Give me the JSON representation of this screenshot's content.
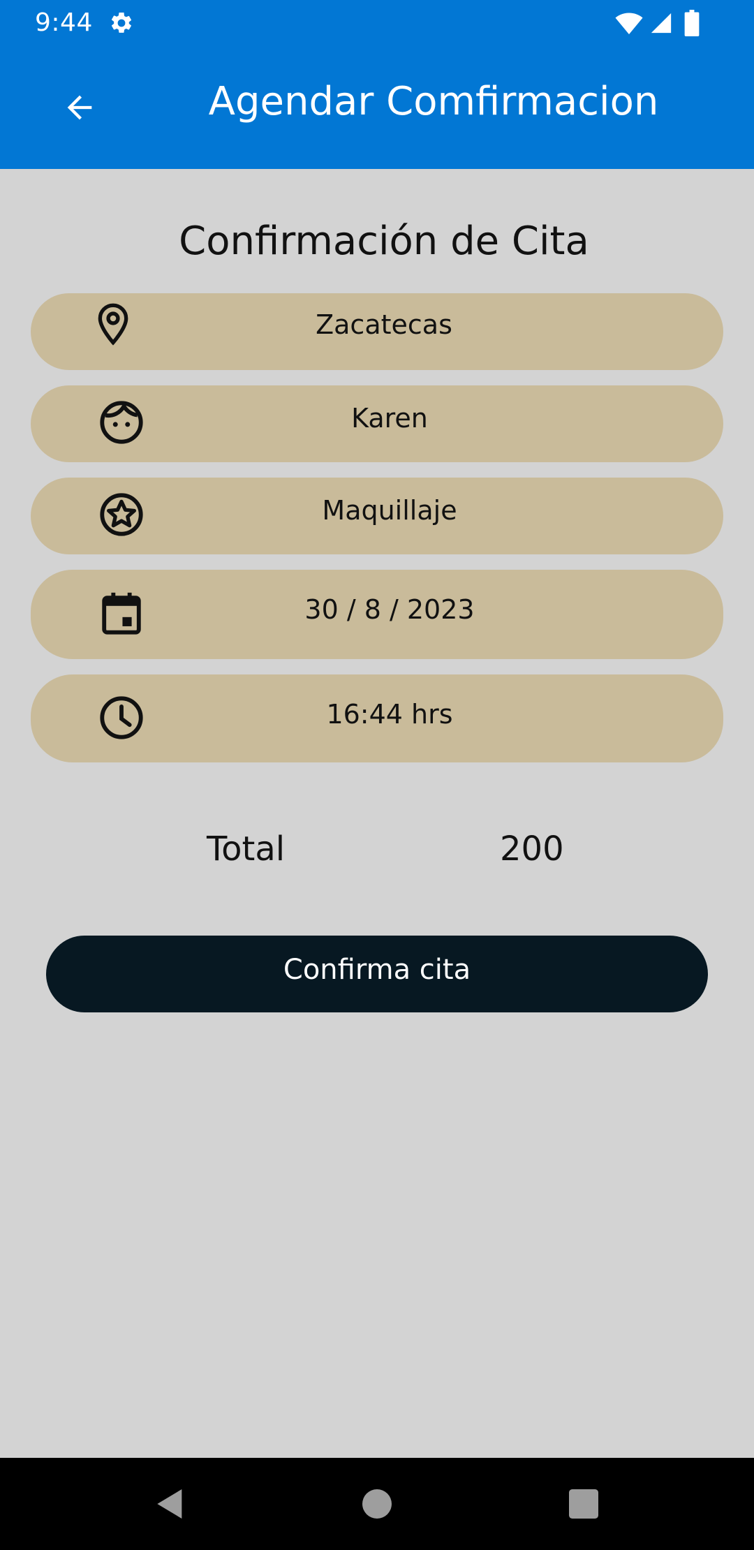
{
  "status_bar": {
    "time": "9:44",
    "icons": [
      "gear-icon",
      "wifi-icon",
      "signal-icon",
      "battery-icon"
    ]
  },
  "app_bar": {
    "title": "Agendar Comfirmacion",
    "back_icon": "arrow-back-icon",
    "color": "#0277d4"
  },
  "main": {
    "section_title": "Confirmación de Cita",
    "items": [
      {
        "icon": "location-pin-icon",
        "value": "Zacatecas"
      },
      {
        "icon": "face-icon",
        "value": "Karen"
      },
      {
        "icon": "star-circle-icon",
        "value": "Maquillaje"
      },
      {
        "icon": "calendar-icon",
        "value": "30 / 8 / 2023"
      },
      {
        "icon": "clock-icon",
        "value": "16:44 hrs"
      }
    ],
    "pill_color": "#c9bb9a",
    "total": {
      "label": "Total",
      "value": "200"
    },
    "confirm_button_label": "Confirma cita",
    "confirm_button_color": "#071822"
  },
  "nav_bar": {
    "buttons": [
      "back-triangle-icon",
      "home-circle-icon",
      "recents-square-icon"
    ]
  }
}
